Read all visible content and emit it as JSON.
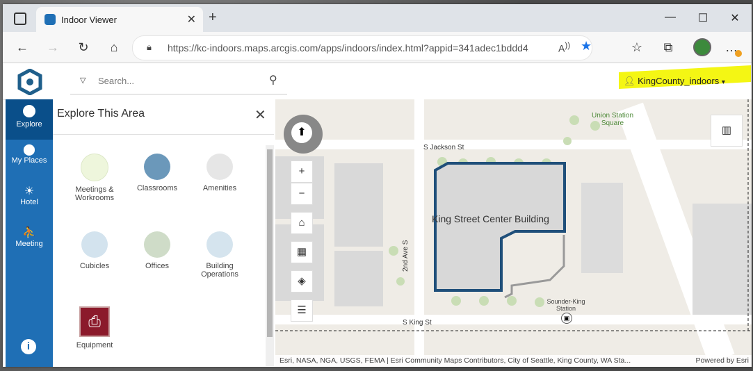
{
  "browser": {
    "tab_title": "Indoor Viewer",
    "url": "https://kc-indoors.maps.arcgis.com/apps/indoors/index.html?appid=341adec1bddd411f97..."
  },
  "search": {
    "placeholder": "Search..."
  },
  "user": {
    "name": "KingCounty_indoors"
  },
  "rail": [
    {
      "label": "Explore",
      "icon": "globe-icon"
    },
    {
      "label": "My Places",
      "icon": "pin-icon"
    },
    {
      "label": "Hotel",
      "icon": "hotel-icon"
    },
    {
      "label": "Meeting",
      "icon": "meeting-icon"
    }
  ],
  "panel": {
    "title": "Explore This Area",
    "categories": [
      {
        "label": "Meetings & Workrooms",
        "color": "#eef6dc"
      },
      {
        "label": "Classrooms",
        "color": "#6b98ba"
      },
      {
        "label": "Amenities",
        "color": "#e6e6e6"
      },
      {
        "label": "Cubicles",
        "color": "#d3e3ee"
      },
      {
        "label": "Offices",
        "color": "#cfdcc8"
      },
      {
        "label": "Building Operations",
        "color": "#d5e4ee"
      },
      {
        "label": "Equipment",
        "color": "#8b1a2b"
      }
    ]
  },
  "map": {
    "building_label": "King Street Center Building",
    "streets": [
      "S Jackson St",
      "S King St",
      "2nd Ave S"
    ],
    "places": [
      "Union Station Square",
      "Sounder-King Station"
    ],
    "attribution": "Esri, NASA, NGA, USGS, FEMA | Esri Community Maps Contributors, City of Seattle, King County, WA Sta...",
    "powered": "Powered by Esri"
  }
}
